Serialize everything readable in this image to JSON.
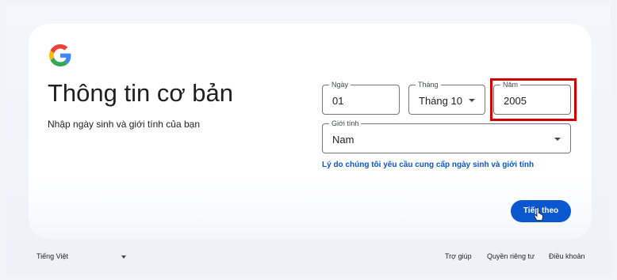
{
  "page": {
    "title": "Thông tin cơ bản",
    "subtitle": "Nhập ngày sinh và giới tính của bạn"
  },
  "form": {
    "day": {
      "label": "Ngày",
      "value": "01"
    },
    "month": {
      "label": "Tháng",
      "value": "Tháng 10"
    },
    "year": {
      "label": "Năm",
      "value": "2005"
    },
    "gender": {
      "label": "Giới tính",
      "value": "Nam"
    },
    "reason_link": "Lý do chúng tôi yêu cầu cung cấp ngày sinh và giới tính",
    "next_button": "Tiếp theo"
  },
  "footer": {
    "language": "Tiếng Việt",
    "help": "Trợ giúp",
    "privacy": "Quyền riêng tư",
    "terms": "Điều khoản"
  },
  "colors": {
    "accent": "#0b57d0",
    "highlight": "#d00000",
    "background": "#f0f4f9"
  },
  "icons": [
    "google-logo",
    "chevron-down-icon",
    "hand-cursor-icon"
  ]
}
